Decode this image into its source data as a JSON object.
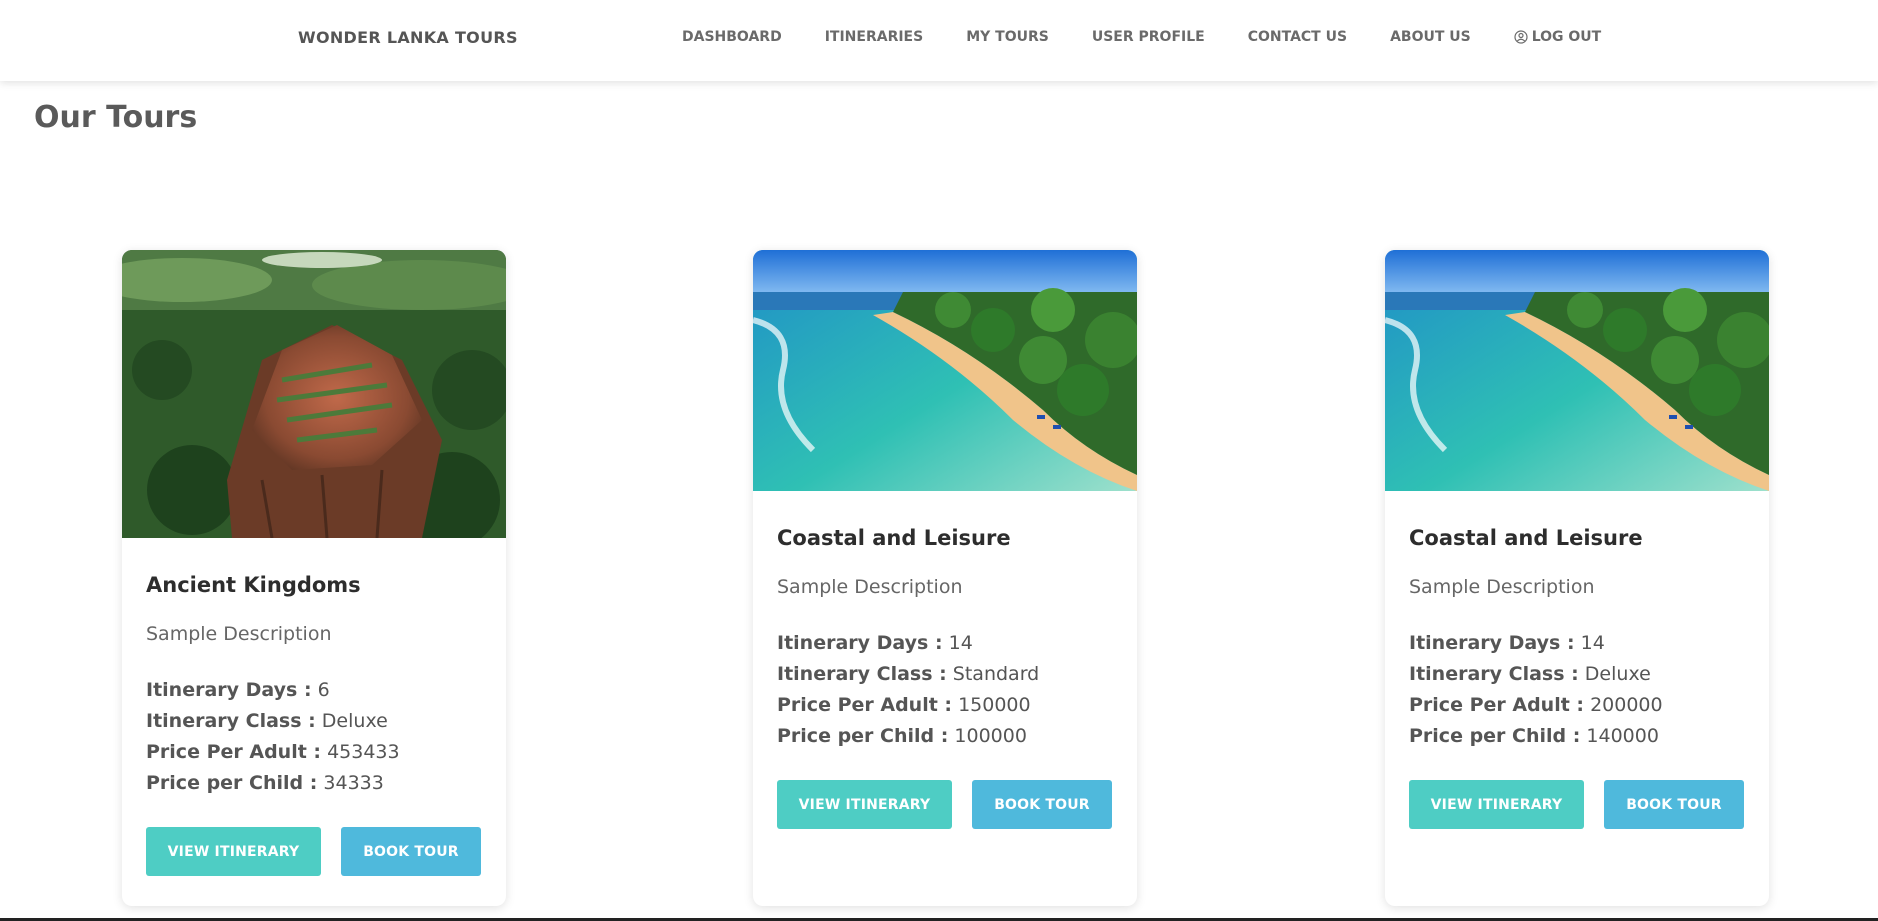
{
  "header": {
    "brand": "WONDER LANKA TOURS",
    "nav": [
      {
        "label": "DASHBOARD"
      },
      {
        "label": "ITINERARIES"
      },
      {
        "label": "MY TOURS"
      },
      {
        "label": "USER PROFILE"
      },
      {
        "label": "CONTACT US"
      },
      {
        "label": "ABOUT US"
      },
      {
        "label": "LOG OUT",
        "icon": "user-circle-icon"
      }
    ]
  },
  "page": {
    "title": "Our Tours"
  },
  "labels": {
    "days": "Itinerary Days :",
    "class": "Itinerary Class :",
    "adult": "Price Per Adult :",
    "child": "Price per Child :",
    "view": "VIEW ITINERARY",
    "book": "BOOK TOUR"
  },
  "tours": [
    {
      "name": "Ancient Kingdoms",
      "description": "Sample Description",
      "days": "6",
      "class": "Deluxe",
      "price_adult": "453433",
      "price_child": "34333",
      "image": "sigiriya-rock-fortress-aerial"
    },
    {
      "name": "Coastal and Leisure",
      "description": "Sample Description",
      "days": "14",
      "class": "Standard",
      "price_adult": "150000",
      "price_child": "100000",
      "image": "tropical-beach-aerial"
    },
    {
      "name": "Coastal and Leisure",
      "description": "Sample Description",
      "days": "14",
      "class": "Deluxe",
      "price_adult": "200000",
      "price_child": "140000",
      "image": "tropical-beach-aerial"
    }
  ],
  "colors": {
    "view_button": "#4ecdc4",
    "book_button": "#4fb9dc",
    "heading": "#5a5a5a"
  }
}
